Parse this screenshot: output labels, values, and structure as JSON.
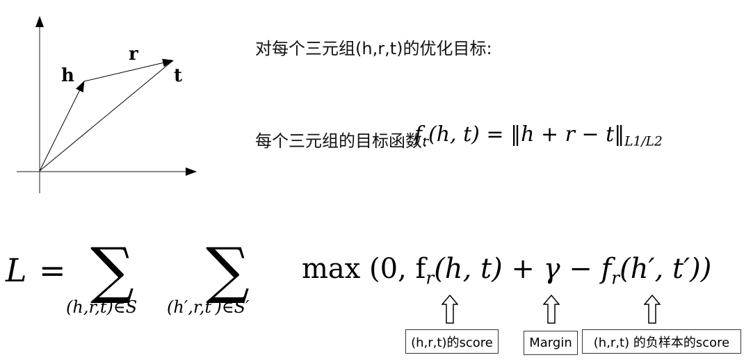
{
  "diagram": {
    "labels": {
      "h": "h",
      "r": "r",
      "t": "t"
    }
  },
  "text": {
    "objective_title": "对每个三元组(h,r,t)的优化目标:",
    "score_function_label": "每个三元组的目标函数:",
    "score_function": {
      "lhs_f": "f",
      "lhs_sub": "r",
      "lhs_args": "(h, t)",
      "eq": "=",
      "norm_body": "‖h + r − t‖",
      "norm_sub": "L1/L2"
    }
  },
  "loss": {
    "lhs": "L",
    "eq": "=",
    "sum1_symbol": "∑",
    "sum1_under": "(h,r,t)∈S",
    "sum2_symbol": "∑",
    "sum2_under": "(h′,r,t′)∈S′",
    "body": "max (0, f",
    "body_sub1": "r",
    "body_mid": "(h, t) + γ − f",
    "body_sub2": "r",
    "body_end": "(h′, t′))"
  },
  "annotations": [
    {
      "label": "(h,r,t)的score"
    },
    {
      "label": "Margin"
    },
    {
      "label": "(h,r,t) 的负样本的score"
    }
  ]
}
